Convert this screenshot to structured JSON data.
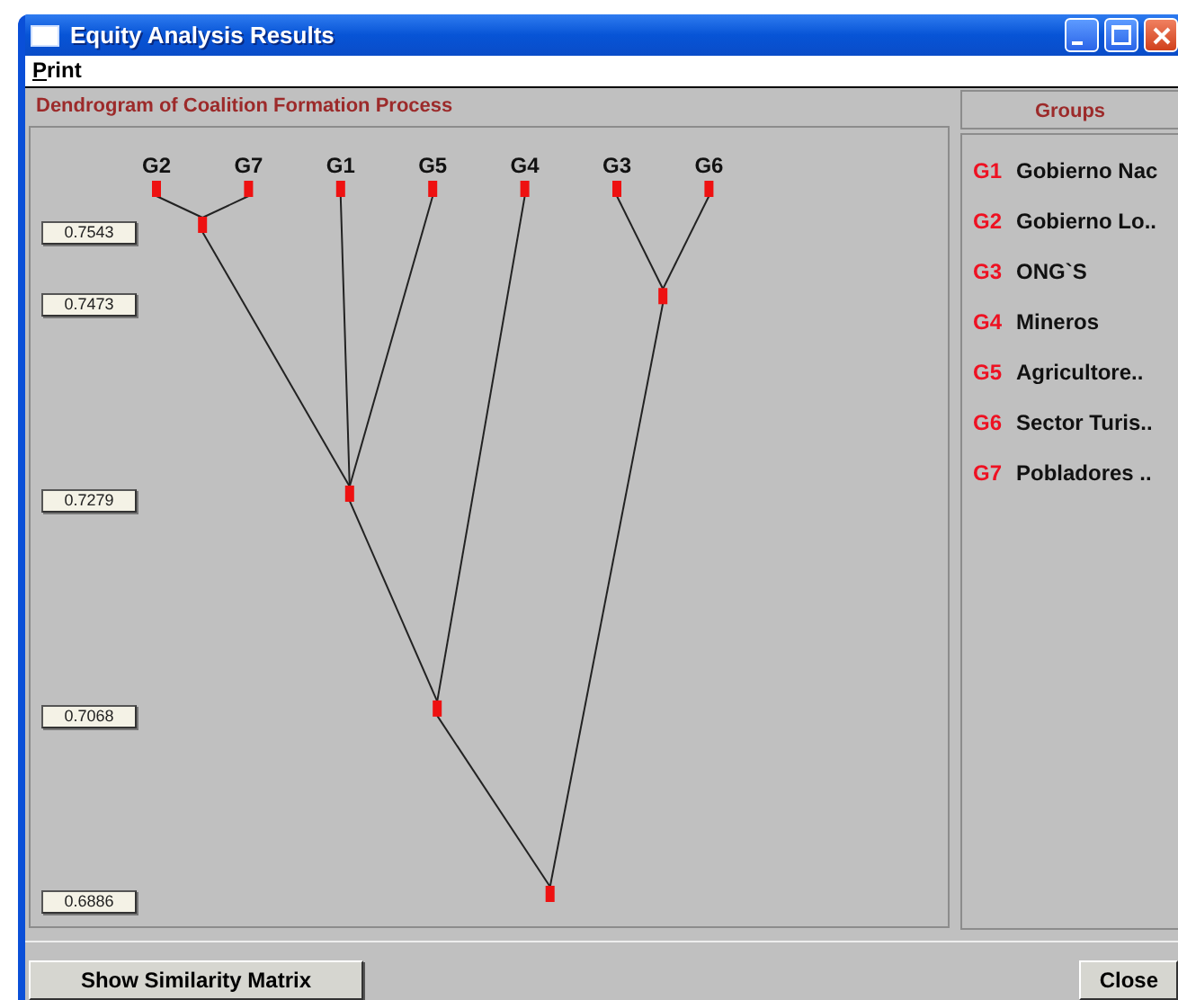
{
  "window": {
    "title": "Equity Analysis Results"
  },
  "menu": [
    {
      "label": "Print",
      "mnemonic_underlined": true
    }
  ],
  "dendrogram": {
    "title": "Dendrogram of Coalition Formation Process",
    "leaves": [
      {
        "label": "G2"
      },
      {
        "label": "G7"
      },
      {
        "label": "G1"
      },
      {
        "label": "G5"
      },
      {
        "label": "G4"
      },
      {
        "label": "G3"
      },
      {
        "label": "G6"
      }
    ],
    "merges": [
      {
        "similarity": "0.7543"
      },
      {
        "similarity": "0.7473"
      },
      {
        "similarity": "0.7279"
      },
      {
        "similarity": "0.7068"
      },
      {
        "similarity": "0.6886"
      }
    ]
  },
  "groups": {
    "title": "Groups",
    "items": [
      {
        "code": "G1",
        "name": "Gobierno Nac"
      },
      {
        "code": "G2",
        "name": "Gobierno Lo.."
      },
      {
        "code": "G3",
        "name": "ONG`S"
      },
      {
        "code": "G4",
        "name": "Mineros"
      },
      {
        "code": "G5",
        "name": "Agricultore.."
      },
      {
        "code": "G6",
        "name": "Sector Turis.."
      },
      {
        "code": "G7",
        "name": "Pobladores .."
      }
    ]
  },
  "buttons": [
    {
      "label": "Show Similarity Matrix"
    },
    {
      "label": "Close"
    }
  ]
}
